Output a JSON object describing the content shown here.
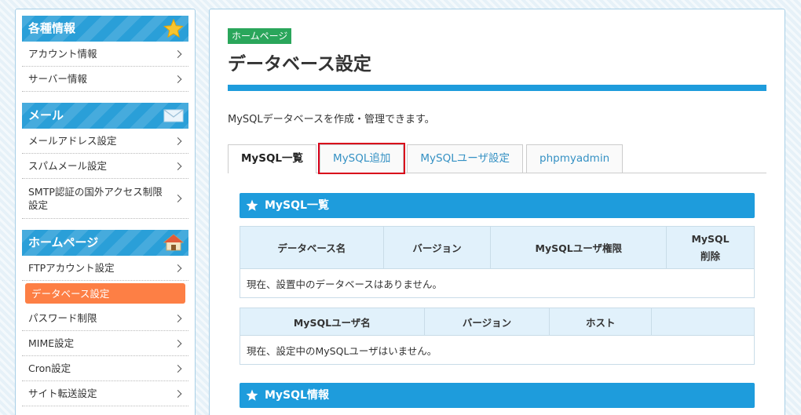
{
  "sidebar": {
    "sections": [
      {
        "title": "各種情報",
        "icon": "star-icon",
        "items": [
          "アカウント情報",
          "サーバー情報"
        ]
      },
      {
        "title": "メール",
        "icon": "mail-icon",
        "items": [
          "メールアドレス設定",
          "スパムメール設定",
          "SMTP認証の国外アクセス制限設定"
        ]
      },
      {
        "title": "ホームページ",
        "icon": "house-icon",
        "items": [
          "FTPアカウント設定",
          "データベース設定",
          "パスワード制限",
          "MIME設定",
          "Cron設定",
          "サイト転送設定"
        ],
        "active": "データベース設定"
      }
    ]
  },
  "main": {
    "badge": "ホームページ",
    "title": "データベース設定",
    "description": "MySQLデータベースを作成・管理できます。",
    "tabs": [
      "MySQL一覧",
      "MySQL追加",
      "MySQLユーザ設定",
      "phpmyadmin"
    ],
    "active_tab": "MySQL一覧",
    "highlighted_tab": "MySQL追加",
    "mysql_list": {
      "heading": "MySQL一覧",
      "db_table": {
        "headers": [
          "データベース名",
          "バージョン",
          "MySQLユーザ権限",
          "MySQL削除"
        ],
        "empty_message": "現在、設置中のデータベースはありません。"
      },
      "user_table": {
        "headers": [
          "MySQLユーザ名",
          "バージョン",
          "ホスト",
          ""
        ],
        "empty_message": "現在、設定中のMySQLユーザはいません。"
      }
    },
    "mysql_info": {
      "heading": "MySQL情報"
    }
  },
  "colors": {
    "header_blue": "#2a9fd8",
    "accent_orange": "#fd7f45",
    "badge_green": "#2aa65b",
    "highlight_red": "#d9001a"
  }
}
